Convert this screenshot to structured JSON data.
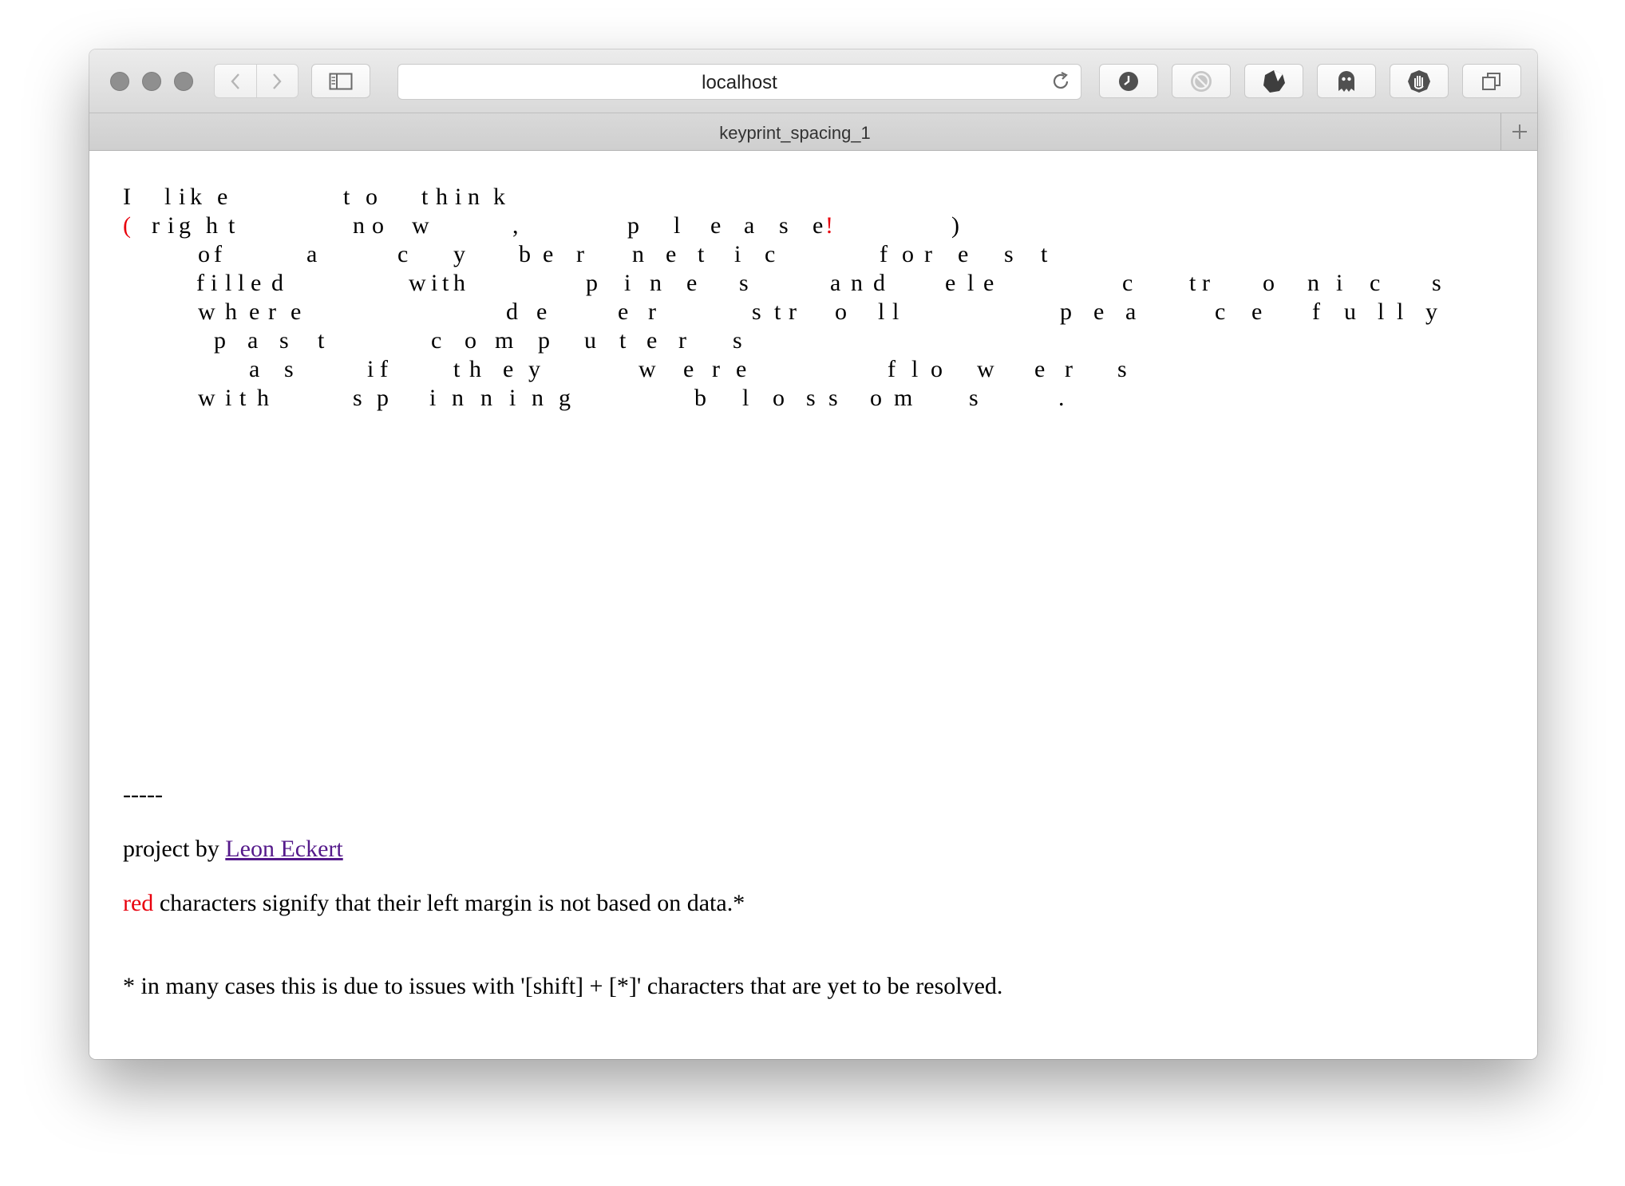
{
  "browser": {
    "address": "localhost",
    "tab_title": "keyprint_spacing_1",
    "toolbar_icons": [
      "history-icon",
      "block-icon",
      "ghostery-icon",
      "ghost-icon",
      "hand-icon",
      "tabs-overview-icon"
    ]
  },
  "poem": {
    "lines": [
      [
        [
          "I",
          0
        ],
        [
          "l",
          52
        ],
        [
          "i",
          70
        ],
        [
          "k",
          84
        ],
        [
          "e",
          118
        ],
        [
          "t",
          276
        ],
        [
          "o",
          304
        ],
        [
          "t",
          374
        ],
        [
          "h",
          392
        ],
        [
          "i",
          416
        ],
        [
          "n",
          432
        ],
        [
          "k",
          464
        ]
      ],
      [
        [
          "(",
          0,
          true
        ],
        [
          "r",
          36
        ],
        [
          "i",
          56
        ],
        [
          "g",
          70
        ],
        [
          "h",
          104
        ],
        [
          "t",
          132
        ],
        [
          "n",
          288
        ],
        [
          "o",
          312
        ],
        [
          "w",
          362
        ],
        [
          ",",
          488
        ],
        [
          "p",
          632
        ],
        [
          "l",
          690
        ],
        [
          "e",
          736
        ],
        [
          "a",
          778
        ],
        [
          "s",
          822
        ],
        [
          "e",
          864
        ],
        [
          "!",
          880,
          true
        ],
        [
          ")",
          1038
        ]
      ],
      [
        [
          "o",
          94
        ],
        [
          "f",
          114
        ],
        [
          "a",
          230
        ],
        [
          "c",
          344
        ],
        [
          "y",
          414
        ],
        [
          "b",
          496
        ],
        [
          "e",
          526
        ],
        [
          "r",
          568
        ],
        [
          "n",
          638
        ],
        [
          "e",
          680
        ],
        [
          "t",
          720
        ],
        [
          "i",
          766
        ],
        [
          "c",
          804
        ],
        [
          "f",
          948
        ],
        [
          "o",
          976
        ],
        [
          "r",
          1004
        ],
        [
          "e",
          1046
        ],
        [
          "s",
          1104
        ],
        [
          "t",
          1150
        ]
      ],
      [
        [
          "f",
          92
        ],
        [
          "i",
          110
        ],
        [
          "l",
          128
        ],
        [
          "l",
          144
        ],
        [
          "e",
          160
        ],
        [
          "d",
          186
        ],
        [
          "w",
          358
        ],
        [
          "i",
          386
        ],
        [
          "t",
          400
        ],
        [
          "h",
          414
        ],
        [
          "p",
          580
        ],
        [
          "i",
          628
        ],
        [
          "n",
          660
        ],
        [
          "e",
          706
        ],
        [
          "s",
          772
        ],
        [
          "a",
          886
        ],
        [
          "n",
          912
        ],
        [
          "d",
          940
        ],
        [
          "e",
          1030
        ],
        [
          "l",
          1058
        ],
        [
          "e",
          1078
        ],
        [
          "c",
          1252
        ],
        [
          "t",
          1336
        ],
        [
          "r",
          1352
        ],
        [
          "o",
          1428
        ],
        [
          "n",
          1484
        ],
        [
          "i",
          1520
        ],
        [
          "c",
          1562
        ],
        [
          "s",
          1640
        ]
      ],
      [
        [
          "w",
          94
        ],
        [
          "h",
          128
        ],
        [
          "e",
          158
        ],
        [
          "r",
          182
        ],
        [
          "e",
          210
        ],
        [
          "d",
          480
        ],
        [
          "e",
          518
        ],
        [
          "e",
          620
        ],
        [
          "r",
          658
        ],
        [
          "s",
          788
        ],
        [
          "t",
          816
        ],
        [
          "r",
          834
        ],
        [
          "o",
          892
        ],
        [
          "l",
          946
        ],
        [
          "l",
          964
        ],
        [
          "p",
          1174
        ],
        [
          "e",
          1216
        ],
        [
          "a",
          1256
        ],
        [
          "c",
          1368
        ],
        [
          "e",
          1414
        ],
        [
          "f",
          1490
        ],
        [
          "u",
          1530
        ],
        [
          "l",
          1572
        ],
        [
          "l",
          1596
        ],
        [
          "y",
          1632
        ]
      ],
      [
        [
          "p",
          114
        ],
        [
          "a",
          156
        ],
        [
          "s",
          196
        ],
        [
          "t",
          244
        ],
        [
          "c",
          386
        ],
        [
          "o",
          428
        ],
        [
          "m",
          466
        ],
        [
          "p",
          520
        ],
        [
          "u",
          578
        ],
        [
          "t",
          622
        ],
        [
          "e",
          656
        ],
        [
          "r",
          696
        ],
        [
          "s",
          764
        ]
      ],
      [
        [
          "a",
          158
        ],
        [
          "s",
          202
        ],
        [
          "i",
          306
        ],
        [
          "f",
          322
        ],
        [
          "t",
          414
        ],
        [
          "h",
          434
        ],
        [
          "e",
          476
        ],
        [
          "y",
          508
        ],
        [
          "w",
          646
        ],
        [
          "e",
          702
        ],
        [
          "r",
          738
        ],
        [
          "e",
          768
        ],
        [
          "f",
          958
        ],
        [
          "l",
          988
        ],
        [
          "o",
          1012
        ],
        [
          "w",
          1070
        ],
        [
          "e",
          1142
        ],
        [
          "r",
          1180
        ],
        [
          "s",
          1246
        ]
      ],
      [
        [
          "w",
          94
        ],
        [
          "i",
          128
        ],
        [
          "t",
          146
        ],
        [
          "h",
          168
        ],
        [
          "s",
          288
        ],
        [
          "p",
          318
        ],
        [
          "i",
          384
        ],
        [
          "n",
          412
        ],
        [
          "n",
          448
        ],
        [
          "i",
          484
        ],
        [
          "n",
          512
        ],
        [
          "g",
          546
        ],
        [
          "b",
          716
        ],
        [
          "l",
          776
        ],
        [
          "o",
          814
        ],
        [
          "s",
          856
        ],
        [
          "s",
          884
        ],
        [
          "o",
          936
        ],
        [
          "m",
          966
        ],
        [
          "s",
          1060
        ],
        [
          ".",
          1172
        ]
      ]
    ]
  },
  "footer": {
    "divider": "-----",
    "credit_prefix": "project by ",
    "credit_link": "Leon Eckert",
    "note_red": "red",
    "note_rest": " characters signify that their left margin is not based on data.*",
    "footnote": "* in many cases this is due to issues with '[shift] + [*]' characters that are yet to be resolved."
  },
  "colors": {
    "red_char": "#e8000d",
    "link": "#551a8b"
  }
}
